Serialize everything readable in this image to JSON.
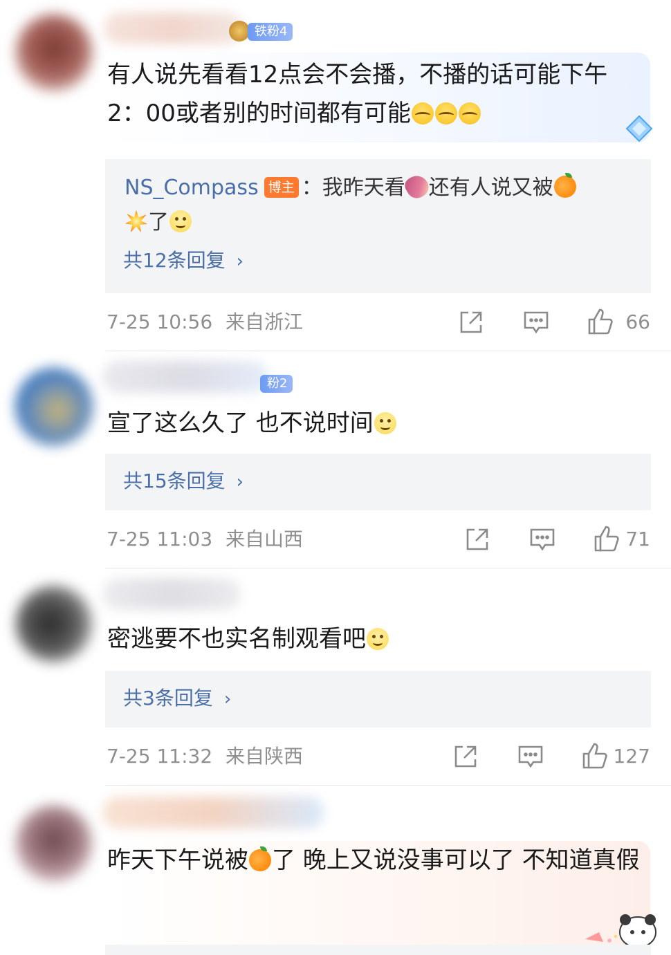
{
  "comments": [
    {
      "badge": "铁粉4",
      "text": "有人说先看看12点会不会播，不播的话可能下午2：00或者别的时间都有可能",
      "reply": {
        "user": "NS_Compass",
        "tag": "博主",
        "text_a": "：我昨天看",
        "text_b": "还有人说又被",
        "text_c": "了",
        "count": "共12条回复"
      },
      "time": "7-25 10:56",
      "location": "来自浙江",
      "likes": "66"
    },
    {
      "badge": "粉2",
      "text": "宣了这么久了 也不说时间",
      "reply": {
        "count": "共15条回复"
      },
      "time": "7-25 11:03",
      "location": "来自山西",
      "likes": "71"
    },
    {
      "text": "密逃要不也实名制观看吧",
      "reply": {
        "count": "共3条回复"
      },
      "time": "7-25 11:32",
      "location": "来自陕西",
      "likes": "127"
    },
    {
      "text_a": "昨天下午说被",
      "text_b": "了 晚上又说没事可以了 不知道真假"
    }
  ],
  "icons": {
    "share": "share-icon",
    "comment": "comment-icon",
    "like": "thumbs-up-icon",
    "chevron": "chevron-right-icon",
    "emoji_tear": "laughing-tears-emoji",
    "emoji_smile": "smile-emoji",
    "emoji_orange": "orange-emoji",
    "emoji_potato": "sweet-potato-emoji",
    "emoji_boom": "explosion-emoji"
  },
  "colors": {
    "link": "#4a6fa8",
    "meta": "#8f8f8f",
    "reply_bg": "#f3f4f6",
    "badge": "#6c9bf4",
    "blogger_tag": "#ff7a2e"
  }
}
